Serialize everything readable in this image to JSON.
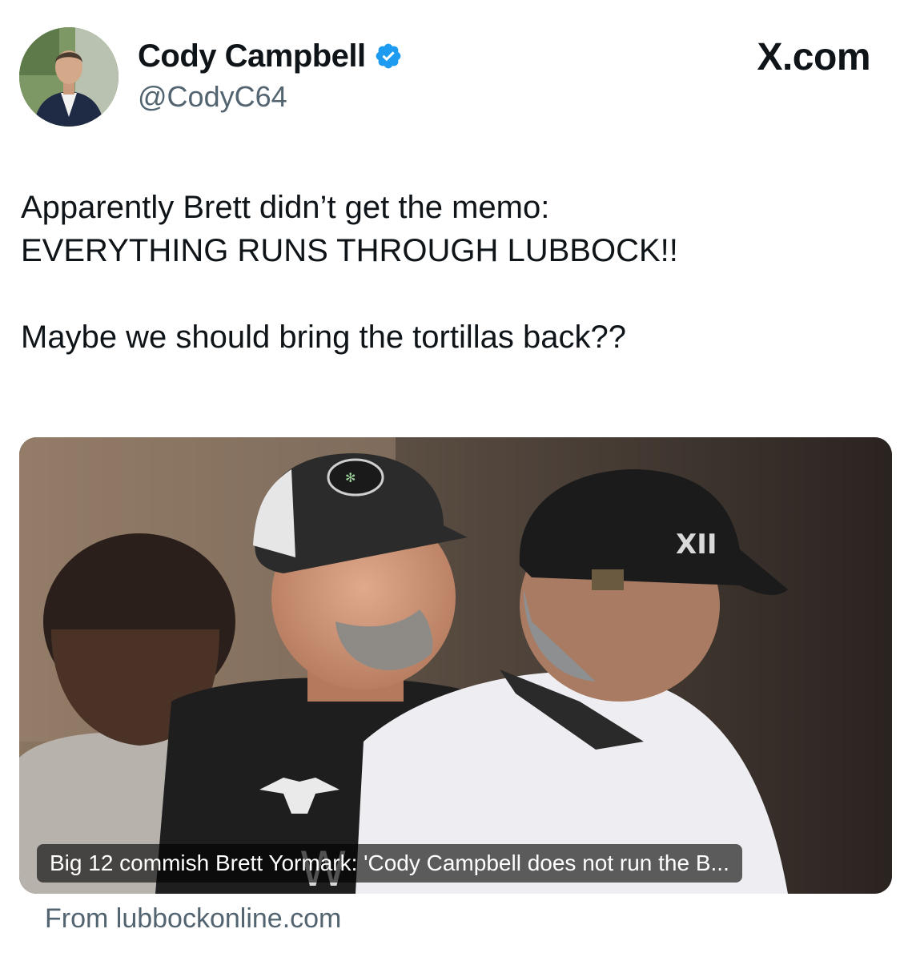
{
  "author": {
    "display_name": "Cody Campbell",
    "handle": "@CodyC64",
    "verified_icon": "verified-badge-icon",
    "avatar": "profile-photo"
  },
  "brand": {
    "label": "X.com"
  },
  "tweet": {
    "line1": "Apparently Brett didn’t get the memo:",
    "line2": "EVERYTHING RUNS THROUGH LUBBOCK!!",
    "line3": "Maybe we should bring the tortillas back??"
  },
  "link_card": {
    "title": "Big 12 commish Brett Yormark: 'Cody Campbell does not run the B...",
    "source": "From lubbockonline.com"
  },
  "colors": {
    "text_primary": "#0f1419",
    "text_secondary": "#536471",
    "verified_blue": "#1d9bf0"
  }
}
